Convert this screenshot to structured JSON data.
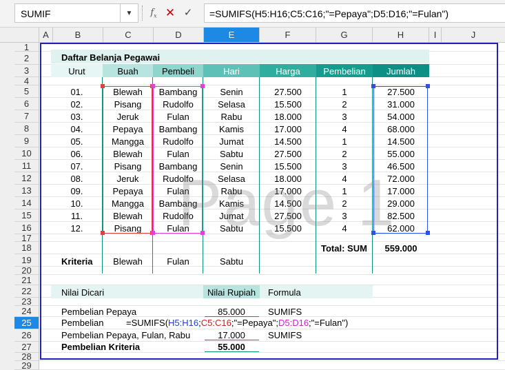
{
  "formula_bar": {
    "name_box": "SUMIF",
    "formula": "=SUMIFS(H5:H16;C5:C16;\"=Pepaya\";D5:D16;\"=Fulan\")"
  },
  "columns": [
    "A",
    "B",
    "C",
    "D",
    "E",
    "F",
    "G",
    "H",
    "I",
    "J"
  ],
  "rows": [
    "1",
    "2",
    "3",
    "4",
    "5",
    "6",
    "7",
    "8",
    "9",
    "10",
    "11",
    "12",
    "13",
    "14",
    "15",
    "16",
    "17",
    "18",
    "19",
    "20",
    "21",
    "22",
    "23",
    "24",
    "25",
    "26",
    "27",
    "28",
    "29"
  ],
  "watermark": "Page 1",
  "table": {
    "title": "Daftar Belanja Pegawai",
    "headers": [
      "Urut",
      "Buah",
      "Pembeli",
      "Hari",
      "Harga",
      "Pembelian",
      "Jumlah"
    ],
    "rows": [
      [
        "01.",
        "Blewah",
        "Bambang",
        "Senin",
        "27.500",
        "1",
        "27.500"
      ],
      [
        "02.",
        "Pisang",
        "Rudolfo",
        "Selasa",
        "15.500",
        "2",
        "31.000"
      ],
      [
        "03.",
        "Jeruk",
        "Fulan",
        "Rabu",
        "18.000",
        "3",
        "54.000"
      ],
      [
        "04.",
        "Pepaya",
        "Bambang",
        "Kamis",
        "17.000",
        "4",
        "68.000"
      ],
      [
        "05.",
        "Mangga",
        "Rudolfo",
        "Jumat",
        "14.500",
        "1",
        "14.500"
      ],
      [
        "06.",
        "Blewah",
        "Fulan",
        "Sabtu",
        "27.500",
        "2",
        "55.000"
      ],
      [
        "07.",
        "Pisang",
        "Bambang",
        "Senin",
        "15.500",
        "3",
        "46.500"
      ],
      [
        "08.",
        "Jeruk",
        "Rudolfo",
        "Selasa",
        "18.000",
        "4",
        "72.000"
      ],
      [
        "09.",
        "Pepaya",
        "Fulan",
        "Rabu",
        "17.000",
        "1",
        "17.000"
      ],
      [
        "10.",
        "Mangga",
        "Bambang",
        "Kamis",
        "14.500",
        "2",
        "29.000"
      ],
      [
        "11.",
        "Blewah",
        "Rudolfo",
        "Jumat",
        "27.500",
        "3",
        "82.500"
      ],
      [
        "12.",
        "Pisang",
        "Fulan",
        "Sabtu",
        "15.500",
        "4",
        "62.000"
      ]
    ],
    "total_label": "Total: SUM",
    "total_value": "559.000",
    "criteria_label": "Kriteria",
    "criteria_buah": "Blewah",
    "criteria_pembeli": "Fulan",
    "criteria_hari": "Sabtu"
  },
  "summary": {
    "header_nilai_dicari": "Nilai Dicari",
    "header_nilai_rupiah": "Nilai Rupiah",
    "header_formula": "Formula",
    "row1_label": "Pembelian Pepaya",
    "row1_value": "85.000",
    "row1_formula": "SUMIFS",
    "row2_label": "Pembelian",
    "row2_f_prefix": "=SUMIFS(",
    "row2_f_r1": "H5:H16",
    "row2_f_s1": ";",
    "row2_f_r2": "C5:C16",
    "row2_f_s2": ";\"=Pepaya\";",
    "row2_f_r3": "D5:D16",
    "row2_f_suffix": ";\"=Fulan\")",
    "row3_label": "Pembelian Pepaya, Fulan, Rabu",
    "row3_value": "17.000",
    "row3_formula": "SUMIFS",
    "row4_label": "Pembelian Kriteria",
    "row4_value": "55.000"
  },
  "colors": {
    "header_teal": "#0e8f86",
    "band_light": "#dff2f0",
    "selection_blue": "#1e88e5",
    "frame_blue": "#2222bb"
  }
}
